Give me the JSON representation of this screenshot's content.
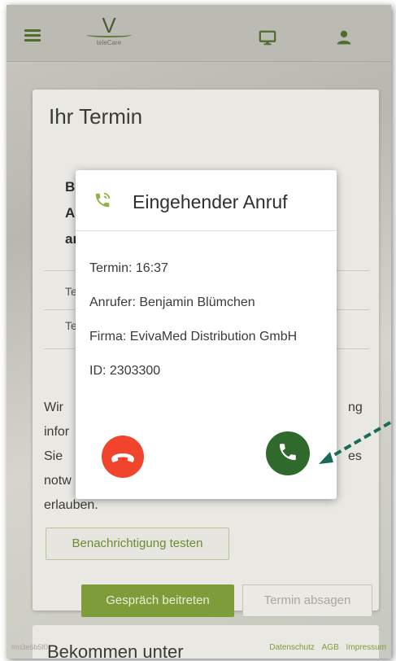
{
  "header": {
    "logo_letter": "V",
    "logo_text": "teleCare",
    "icons": [
      "menu-icon",
      "monitor-icon",
      "user-icon"
    ]
  },
  "card": {
    "title": "Ihr Termin",
    "bold_lines": [
      "Bi",
      "Ar",
      "ar"
    ],
    "small_lines": [
      "Te",
      "Te"
    ],
    "text_lines": [
      "Wir",
      "infor",
      "Sie",
      "notw",
      "erlauben."
    ],
    "right_fragments": [
      "ng",
      "es"
    ],
    "test_button": "Benachrichtigung testen",
    "join_button": "Gespräch beitreten",
    "cancel_button": "Termin absagen"
  },
  "second_card": {
    "title": "Bekommen unter"
  },
  "footer": {
    "left": "#m3e6b5f0",
    "links": [
      "Datenschutz",
      "AGB",
      "Impressum"
    ]
  },
  "modal": {
    "title": "Eingehender Anruf",
    "termin": "Termin: 16:37",
    "anrufer": "Anrufer: Benjamin Blümchen",
    "firma": "Firma: EvivaMed Distribution GmbH",
    "id": "ID: 2303300",
    "icons": [
      "phone-ring-icon",
      "decline-call-icon",
      "accept-call-icon"
    ]
  },
  "colors": {
    "accent_green": "#7f9c3a",
    "accept_green": "#2f6a2c",
    "decline_red": "#f0452c",
    "arrow_teal": "#1a6b5a"
  }
}
